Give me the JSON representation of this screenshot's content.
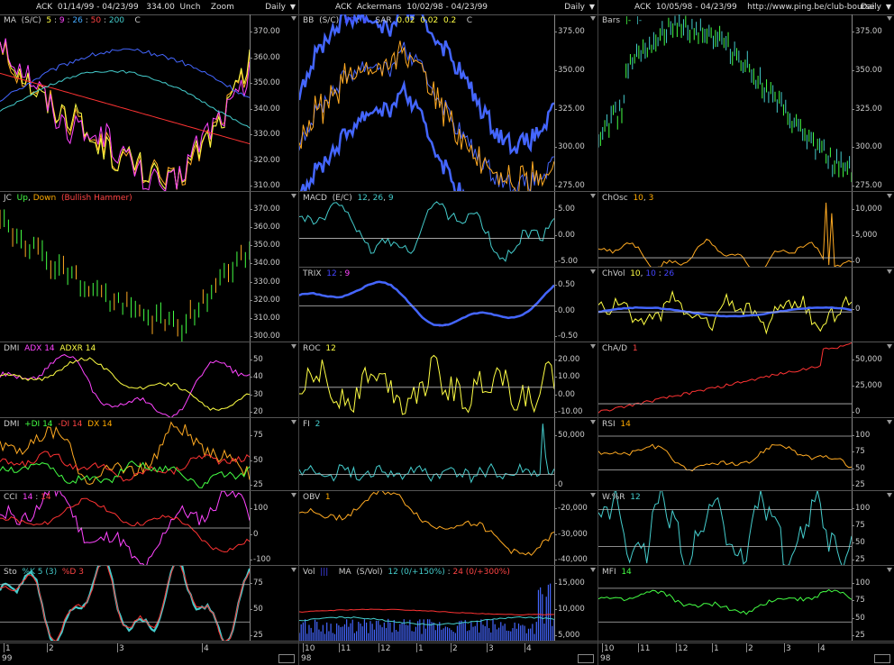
{
  "columns": [
    {
      "id": "c1",
      "header": "ACK  01/14/99 - 04/23/99   334.00  Unch    Zoom",
      "period": "Daily",
      "x_labels": [
        "1",
        "2",
        "3",
        "4"
      ],
      "year_label": "99",
      "panels": [
        {
          "title": [
            [
              "MA  (S/C)  ",
              "#ccc"
            ],
            [
              "5",
              "#ff4"
            ],
            [
              " : ",
              "#ccc"
            ],
            [
              "9",
              "#f4f"
            ],
            [
              " : ",
              "#ccc"
            ],
            [
              "26",
              "#4af"
            ],
            [
              " : ",
              "#ccc"
            ],
            [
              "50",
              "#f44"
            ],
            [
              " : ",
              "#ccc"
            ],
            [
              "200",
              "#4cc"
            ],
            [
              "    C",
              "#ccc"
            ]
          ],
          "yticks": [
            "370.00",
            "360.00",
            "350.00",
            "340.00",
            "330.00",
            "320.00",
            "310.00"
          ]
        },
        {
          "title": [
            [
              "JC  ",
              "#ccc"
            ],
            [
              "Up",
              "#4f4"
            ],
            [
              ", ",
              "#ccc"
            ],
            [
              "Down",
              "#fa0"
            ],
            [
              "  (Bullish Hammer)",
              "#f44"
            ]
          ],
          "yticks": [
            "370.00",
            "360.00",
            "350.00",
            "340.00",
            "330.00",
            "320.00",
            "310.00",
            "300.00"
          ]
        },
        {
          "title": [
            [
              "DMI  ",
              "#ccc"
            ],
            [
              "ADX 14",
              "#f4f"
            ],
            [
              "  ",
              "#ccc"
            ],
            [
              "ADXR 14",
              "#ff4"
            ]
          ],
          "yticks": [
            "50",
            "40",
            "30",
            "20"
          ]
        },
        {
          "title": [
            [
              "DMI  ",
              "#ccc"
            ],
            [
              "+DI 14",
              "#4f4"
            ],
            [
              "  ",
              "#ccc"
            ],
            [
              "-DI 14",
              "#f44"
            ],
            [
              "  ",
              "#ccc"
            ],
            [
              "DX 14",
              "#fa0"
            ]
          ],
          "yticks": [
            "75",
            "50",
            "25"
          ]
        },
        {
          "title": [
            [
              "CCI  ",
              "#ccc"
            ],
            [
              "14",
              "#f4f"
            ],
            [
              " : ",
              "#ccc"
            ],
            [
              "14",
              "#f44"
            ]
          ],
          "yticks": [
            "100",
            "0",
            "-100"
          ]
        },
        {
          "title": [
            [
              "Sto  ",
              "#ccc"
            ],
            [
              "%K 5 (3)",
              "#4cc"
            ],
            [
              "  ",
              "#ccc"
            ],
            [
              "%D 3",
              "#f44"
            ]
          ],
          "yticks": [
            "75",
            "50",
            "25"
          ]
        }
      ]
    },
    {
      "id": "c2",
      "header": "ACK  Ackermans  10/02/98 - 04/23/99",
      "period": "Daily",
      "x_labels": [
        "10",
        "11",
        "12",
        "1",
        "2",
        "3",
        "4"
      ],
      "year_label": "98",
      "panels": [
        {
          "title": [
            [
              "BB  (S/C)  ",
              "#ccc"
            ],
            [
              "20",
              "#44f"
            ],
            [
              " : ",
              "#ccc"
            ],
            [
              "2",
              "#44f"
            ],
            [
              "   SAR  ",
              "#ccc"
            ],
            [
              "0.02",
              "#ff4"
            ],
            [
              "  ",
              "#ccc"
            ],
            [
              "0.02",
              "#ff4"
            ],
            [
              "  ",
              "#ccc"
            ],
            [
              "0.2",
              "#ff4"
            ],
            [
              "    C",
              "#ccc"
            ]
          ],
          "yticks": [
            "375.00",
            "350.00",
            "325.00",
            "300.00",
            "275.00"
          ]
        },
        {
          "title": [
            [
              "MACD  (E/C)  ",
              "#ccc"
            ],
            [
              "12",
              "#4cc"
            ],
            [
              ", ",
              "#ccc"
            ],
            [
              "26",
              "#4cc"
            ],
            [
              ", ",
              "#ccc"
            ],
            [
              "9",
              "#4cc"
            ]
          ],
          "yticks": [
            "5.00",
            "0.00",
            "-5.00"
          ]
        },
        {
          "title": [
            [
              "TRIX  ",
              "#ccc"
            ],
            [
              "12",
              "#44f"
            ],
            [
              " : ",
              "#ccc"
            ],
            [
              "9",
              "#f4f"
            ]
          ],
          "yticks": [
            "0.50",
            "0.00",
            "-0.50"
          ]
        },
        {
          "title": [
            [
              "ROC  ",
              "#ccc"
            ],
            [
              "12",
              "#ff4"
            ]
          ],
          "yticks": [
            "20.00",
            "10.00",
            "0.00",
            "-10.00"
          ]
        },
        {
          "title": [
            [
              "FI  ",
              "#ccc"
            ],
            [
              "2",
              "#4cc"
            ]
          ],
          "yticks": [
            "50,000",
            "0"
          ]
        },
        {
          "title": [
            [
              "OBV  ",
              "#ccc"
            ],
            [
              "1",
              "#fa0"
            ]
          ],
          "yticks": [
            "-20,000",
            "-30,000",
            "-40,000"
          ]
        },
        {
          "title": [
            [
              "Vol  ",
              "#ccc"
            ],
            [
              "|||",
              "#44f"
            ],
            [
              "    MA  (S/Vol)  ",
              "#ccc"
            ],
            [
              "12 (0/+150%)",
              "#4cc"
            ],
            [
              " : ",
              "#ccc"
            ],
            [
              "24 (0/+300%)",
              "#f44"
            ]
          ],
          "yticks": [
            "15,000",
            "10,000",
            "5,000"
          ]
        }
      ]
    },
    {
      "id": "c3",
      "header": "ACK  10/05/98 - 04/23/99    http://www.ping.be/club-bourse",
      "period": "Daily",
      "x_labels": [
        "10",
        "11",
        "12",
        "1",
        "2",
        "3",
        "4"
      ],
      "year_label": "98",
      "panels": [
        {
          "title": [
            [
              "Bars  ",
              "#ccc"
            ],
            [
              "|-",
              "#4f4"
            ],
            [
              "  ",
              "#ccc"
            ],
            [
              "|-",
              "#4cc"
            ]
          ],
          "yticks": [
            "375.00",
            "350.00",
            "325.00",
            "300.00",
            "275.00"
          ]
        },
        {
          "title": [
            [
              "ChOsc  ",
              "#ccc"
            ],
            [
              "10",
              "#fa0"
            ],
            [
              ", ",
              "#ccc"
            ],
            [
              "3",
              "#fa0"
            ]
          ],
          "yticks": [
            "10,000",
            "5,000",
            "0"
          ]
        },
        {
          "title": [
            [
              "ChVol  ",
              "#ccc"
            ],
            [
              "10",
              "#ff4"
            ],
            [
              ", ",
              "#ccc"
            ],
            [
              "10",
              "#44f"
            ],
            [
              " : ",
              "#ccc"
            ],
            [
              "26",
              "#44f"
            ]
          ],
          "yticks": [
            "0"
          ]
        },
        {
          "title": [
            [
              "ChA/D  ",
              "#ccc"
            ],
            [
              "1",
              "#f44"
            ]
          ],
          "yticks": [
            "50,000",
            "25,000",
            "0"
          ]
        },
        {
          "title": [
            [
              "RSI  ",
              "#ccc"
            ],
            [
              "14",
              "#fa0"
            ]
          ],
          "yticks": [
            "100",
            "75",
            "50",
            "25"
          ]
        },
        {
          "title": [
            [
              "W.%R  ",
              "#ccc"
            ],
            [
              "12",
              "#4cc"
            ]
          ],
          "yticks": [
            "100",
            "75",
            "50",
            "25"
          ]
        },
        {
          "title": [
            [
              "MFI  ",
              "#ccc"
            ],
            [
              "14",
              "#4f4"
            ]
          ],
          "yticks": [
            "100",
            "75",
            "50",
            "25"
          ]
        }
      ]
    }
  ],
  "colors": {
    "yellow": "#ffff44",
    "magenta": "#ff44ff",
    "blue": "#4466ff",
    "red": "#ff3333",
    "cyan": "#44cccc",
    "orange": "#ffaa22",
    "green": "#44ff44",
    "darkred": "#cc2222"
  }
}
